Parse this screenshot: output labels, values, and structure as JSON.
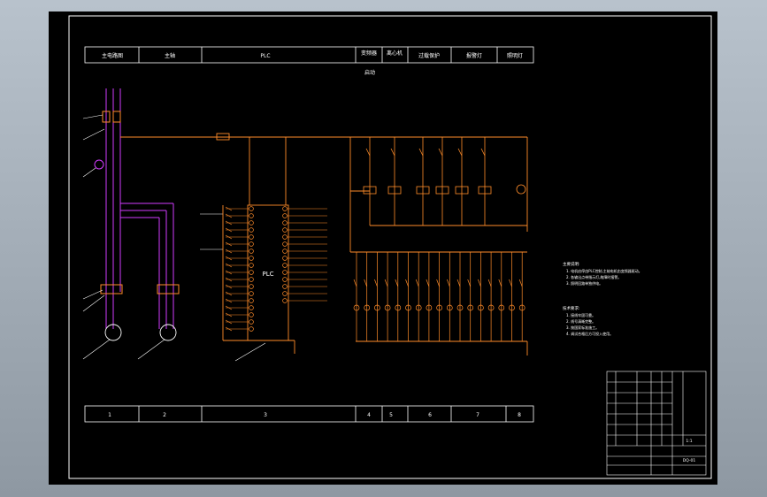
{
  "header": {
    "cells": [
      "主电路图",
      "主轴",
      "PLC",
      "变频器",
      "离心机",
      "过载保护",
      "报警灯",
      "照明灯"
    ],
    "sub": "启动"
  },
  "footer": {
    "cells": [
      "1",
      "2",
      "3",
      "4",
      "5",
      "6",
      "7",
      "8"
    ]
  },
  "plc": {
    "label": "PLC"
  },
  "notes": {
    "title1": "主要说明:",
    "lines1": [
      "1. 电机启停由PLC控制,主轴电机由变频器驱动。",
      "2. 各输出点带指示灯,故障时报警。",
      "3. 照明回路单独供电。"
    ],
    "title2": "技术要求:",
    "lines2": [
      "1. 接线牢固可靠。",
      "2. 线号清晰完整。",
      "3. 按国家标准施工。",
      "4. 调试合格后方可投入使用。"
    ]
  },
  "title_block": {
    "drawing_no": "DQ-01",
    "sheet": "1:1"
  },
  "colors": {
    "background": "#000000",
    "frame": "#ffffff",
    "wire_orange": "#ff8c2a",
    "wire_magenta": "#d23cff",
    "text_white": "#ffffff",
    "gray_surround": "#a9b3bd"
  }
}
